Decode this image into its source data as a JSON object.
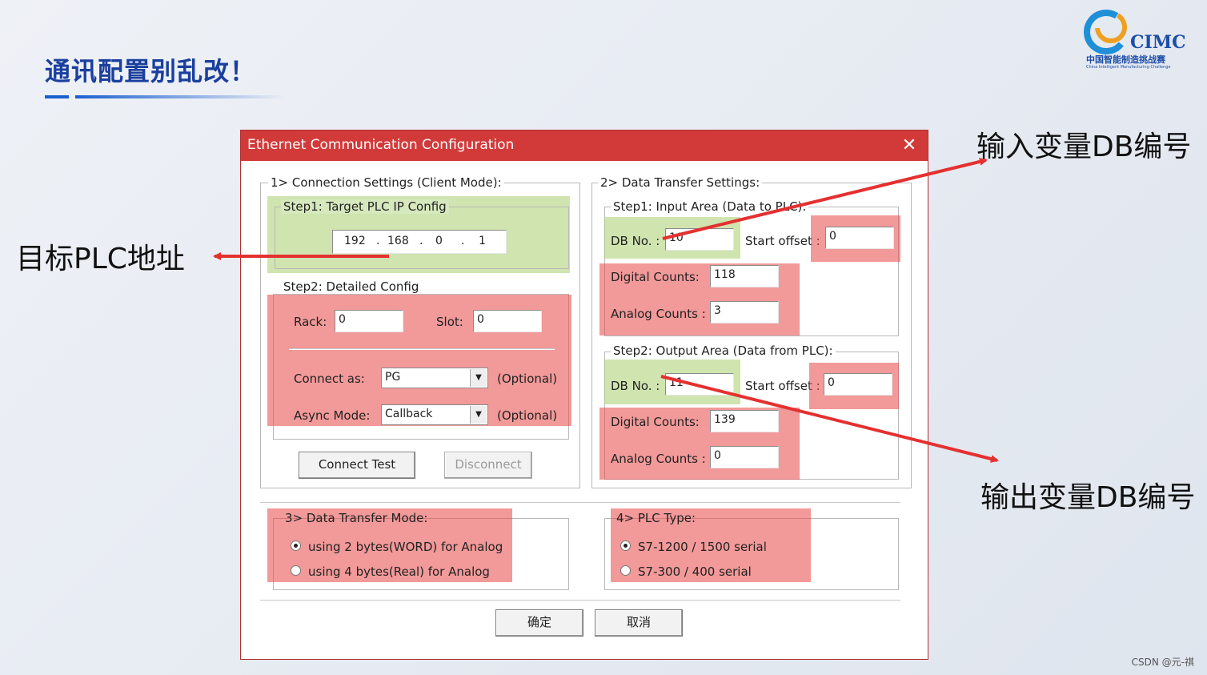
{
  "slide": {
    "title": "通讯配置别乱改！",
    "logo_text": "CIMC",
    "logo_sub": "中国智能制造挑战赛",
    "logo_sub_en": "China Intelligent Manufacturing Challenge",
    "watermark": "CSDN @元-祺"
  },
  "callouts": {
    "target_plc": "目标PLC地址",
    "input_db": "输入变量DB编号",
    "output_db": "输出变量DB编号"
  },
  "colors": {
    "titlebar": "#d23a3a",
    "highlight_red": "#e84646",
    "highlight_green": "#a8cd6e",
    "arrow": "#e53030",
    "title_blue": "#1a3f9e"
  },
  "dialog": {
    "title": "Ethernet Communication Configuration",
    "close_icon": "close-icon",
    "connection": {
      "legend": "1> Connection Settings (Client Mode):",
      "step1_legend": "Step1: Target PLC IP Config",
      "ip": [
        "192",
        "168",
        "0",
        "1"
      ],
      "step2_legend": "Step2: Detailed Config",
      "rack_label": "Rack:",
      "rack_value": "0",
      "slot_label": "Slot:",
      "slot_value": "0",
      "connect_as_label": "Connect as:",
      "connect_as_value": "PG",
      "optional": "(Optional)",
      "async_label": "Async Mode:",
      "async_value": "Callback",
      "connect_test": "Connect Test",
      "disconnect": "Disconnect"
    },
    "transfer": {
      "legend": "2> Data Transfer Settings:",
      "input_legend": "Step1: Input Area (Data to PLC):",
      "db_label": "DB No. :",
      "input_db": "10",
      "start_offset_label": "Start offset :",
      "input_offset": "0",
      "digital_label": "Digital Counts:",
      "input_digital": "118",
      "analog_label": "Analog Counts :",
      "input_analog": "3",
      "output_legend": "Step2: Output Area (Data from PLC):",
      "output_db": "11",
      "output_offset": "0",
      "output_digital": "139",
      "output_analog": "0"
    },
    "mode": {
      "legend": "3> Data Transfer Mode:",
      "opt1": "using 2 bytes(WORD) for Analog",
      "opt2": "using 4 bytes(Real) for Analog",
      "selected": 1
    },
    "plc_type": {
      "legend": "4> PLC Type:",
      "opt1": "S7-1200 / 1500 serial",
      "opt2": "S7-300 / 400 serial",
      "selected": 1
    },
    "ok": "确定",
    "cancel": "取消"
  }
}
